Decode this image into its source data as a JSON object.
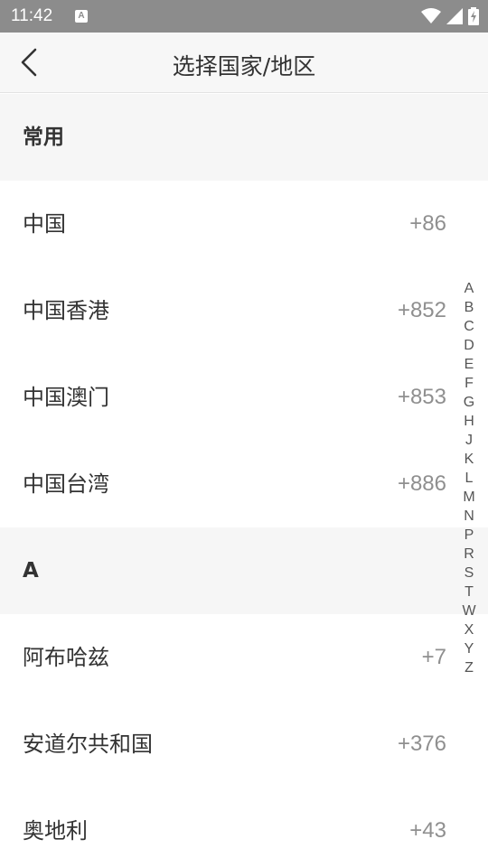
{
  "status_bar": {
    "time": "11:42",
    "notification_icon": "A",
    "icons": [
      "wifi-icon",
      "signal-icon",
      "battery-charging-icon"
    ]
  },
  "header": {
    "title": "选择国家/地区",
    "back_icon": "chevron-left-icon"
  },
  "sections": [
    {
      "title": "常用",
      "items": [
        {
          "name": "中国",
          "code": "+86"
        },
        {
          "name": "中国香港",
          "code": "+852"
        },
        {
          "name": "中国澳门",
          "code": "+853"
        },
        {
          "name": "中国台湾",
          "code": "+886"
        }
      ]
    },
    {
      "title": "A",
      "items": [
        {
          "name": "阿布哈兹",
          "code": "+7"
        },
        {
          "name": "安道尔共和国",
          "code": "+376"
        },
        {
          "name": "奥地利",
          "code": "+43"
        }
      ]
    }
  ],
  "index_letters": [
    "A",
    "B",
    "C",
    "D",
    "E",
    "F",
    "G",
    "H",
    "J",
    "K",
    "L",
    "M",
    "N",
    "P",
    "R",
    "S",
    "T",
    "W",
    "X",
    "Y",
    "Z"
  ]
}
